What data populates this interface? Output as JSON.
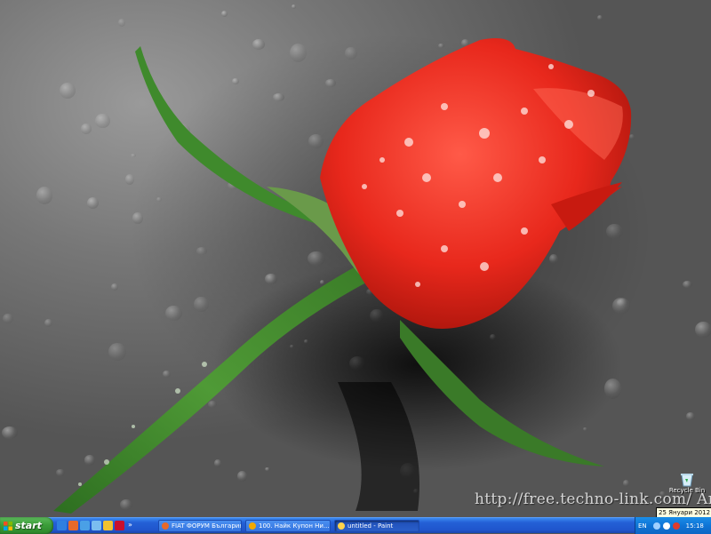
{
  "wallpaper": {
    "subject": "red-rose-with-water-droplets",
    "watermark": "http://free.techno-link.com/ Andy"
  },
  "desktop_icons": [
    {
      "label": "Recycle Bin",
      "icon": "recycle-bin-icon"
    }
  ],
  "tooltip": {
    "date": "25 Януари 2012 г."
  },
  "taskbar": {
    "start_label": "start",
    "quick_launch": [
      {
        "icon": "ie-icon",
        "color": "#2f7fe0"
      },
      {
        "icon": "firefox-icon",
        "color": "#e8692a"
      },
      {
        "icon": "globe-icon",
        "color": "#4aa0e6"
      },
      {
        "icon": "network-icon",
        "color": "#7bbdf0"
      },
      {
        "icon": "lightning-icon",
        "color": "#f2c230"
      },
      {
        "icon": "flag-uk-icon",
        "color": "#c8102e"
      }
    ],
    "tasks": [
      {
        "label": "FIAT ФОРУМ България...",
        "icon": "firefox-icon",
        "icon_color": "#e8692a",
        "active": false
      },
      {
        "label": "100. Найк Купон Ни...",
        "icon": "winamp-icon",
        "icon_color": "#f2a900",
        "active": false
      },
      {
        "label": "untitled - Paint",
        "icon": "paint-icon",
        "icon_color": "#ffd24a",
        "active": true
      }
    ],
    "tray": {
      "language": "EN",
      "icons": [
        {
          "icon": "network-tray-icon",
          "color": "#9fd0ff"
        },
        {
          "icon": "volume-tray-icon",
          "color": "#ffffff"
        },
        {
          "icon": "security-tray-icon",
          "color": "#e03b2b"
        }
      ],
      "clock": "15:18"
    }
  },
  "colors": {
    "taskbar": "#2460d6",
    "start_green": "#3c9e3a",
    "tray_blue": "#0f74d6",
    "rose_red": "#e8281c",
    "stem_green": "#3f8a2c"
  }
}
